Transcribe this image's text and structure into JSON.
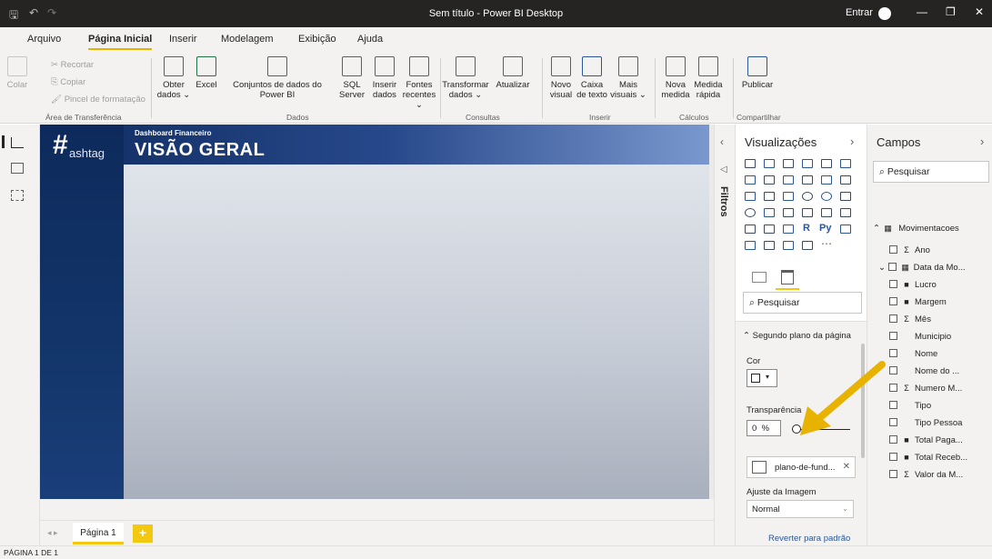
{
  "window": {
    "title": "Sem título - Power BI Desktop",
    "signin_label": "Entrar",
    "min_glyph": "—",
    "max_glyph": "❐",
    "close_glyph": "✕",
    "save_glyph": "🖫",
    "undo_glyph": "↶",
    "redo_glyph": "↷"
  },
  "menu": {
    "tabs": [
      "Arquivo",
      "Página Inicial",
      "Inserir",
      "Modelagem",
      "Exibição",
      "Ajuda"
    ]
  },
  "ribbon": {
    "paste": "Colar",
    "cut": "Recortar",
    "copy": "Copiar",
    "format_painter": "Pincel de formatação",
    "get_data": "Obter dados ⌄",
    "excel": "Excel",
    "power_bi_datasets": "Conjuntos de dados do Power BI",
    "sql_server": "SQL Server",
    "enter_data": "Inserir dados",
    "recent_sources": "Fontes recentes ⌄",
    "transform": "Transformar dados ⌄",
    "refresh": "Atualizar",
    "new_visual": "Novo visual",
    "text_box": "Caixa de texto",
    "more_visuals": "Mais visuais ⌄",
    "new_measure": "Nova medida",
    "quick_measure": "Medida rápida",
    "publish": "Publicar",
    "groups": {
      "clipboard": "Área de Transferência",
      "data": "Dados",
      "queries": "Consultas",
      "insert": "Inserir",
      "calculations": "Cálculos",
      "share": "Compartilhar"
    }
  },
  "report": {
    "logo_hash": "#",
    "logo_text": "ashtag",
    "subtitle": "Dashboard Financeiro",
    "title": "VISÃO GERAL"
  },
  "pages": {
    "tab_label": "Página 1",
    "add_label": "+",
    "status": "PÁGINA 1 DE 1"
  },
  "filters": {
    "label": "Filtros"
  },
  "visualizations": {
    "title": "Visualizações",
    "search_placeholder": "Pesquisar",
    "section": "Segundo plano da página",
    "color_label": "Cor",
    "transparency_label": "Transparência",
    "transparency_value": "0",
    "transparency_unit": "%",
    "image_name": "plano-de-fund...",
    "image_fit_label": "Ajuste da Imagem",
    "image_fit_value": "Normal",
    "reset": "Reverter para padrão"
  },
  "fields": {
    "title": "Campos",
    "search_placeholder": "Pesquisar",
    "table": "Movimentacoes",
    "items": [
      {
        "icon": "Σ",
        "label": "Ano"
      },
      {
        "icon": "▦",
        "label": "Data da Mo..."
      },
      {
        "icon": "■",
        "label": "Lucro"
      },
      {
        "icon": "■",
        "label": "Margem"
      },
      {
        "icon": "Σ",
        "label": "Mês"
      },
      {
        "icon": "",
        "label": "Municipio"
      },
      {
        "icon": "",
        "label": "Nome"
      },
      {
        "icon": "",
        "label": "Nome do ..."
      },
      {
        "icon": "Σ",
        "label": "Numero M..."
      },
      {
        "icon": "",
        "label": "Tipo"
      },
      {
        "icon": "",
        "label": "Tipo Pessoa"
      },
      {
        "icon": "■",
        "label": "Total Paga..."
      },
      {
        "icon": "■",
        "label": "Total Receb..."
      },
      {
        "icon": "Σ",
        "label": "Valor da M..."
      }
    ]
  },
  "colors": {
    "accent": "#f2c811",
    "arrow": "#e8b200",
    "title_bar": "#252423",
    "report_navy": "#123468"
  }
}
